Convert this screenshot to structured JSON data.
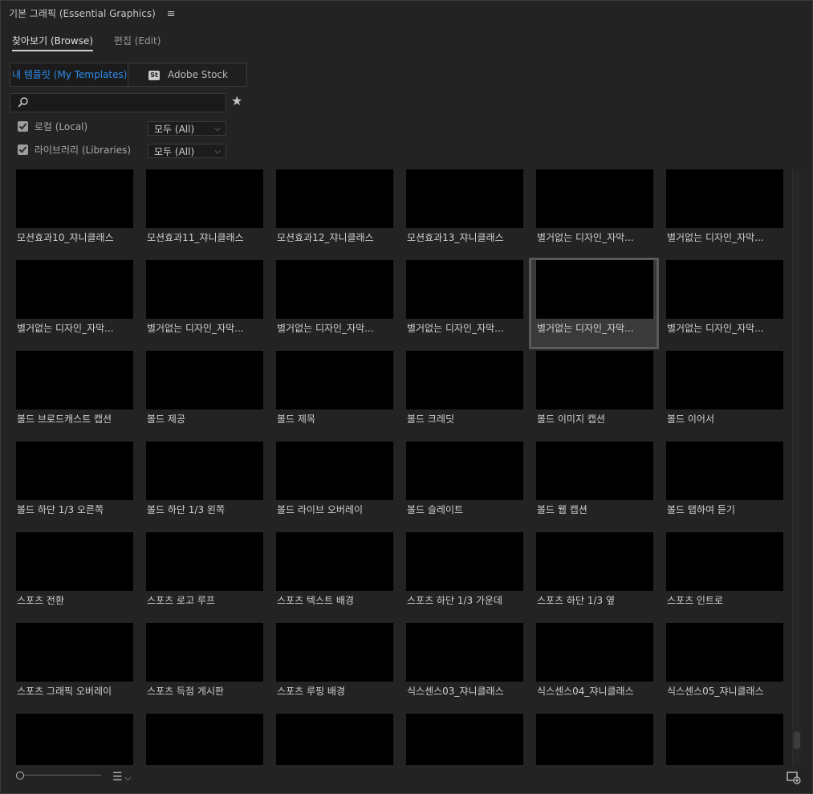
{
  "panel": {
    "title": "기본 그래픽 (Essential Graphics)",
    "menu_icon": "hamburger-icon"
  },
  "tabs": [
    {
      "label": "찾아보기 (Browse)",
      "active": true
    },
    {
      "label": "편집 (Edit)",
      "active": false
    }
  ],
  "source_toggle": {
    "my_templates": "내 템플릿 (My Templates)",
    "stock_badge": "St",
    "adobe_stock": "Adobe Stock"
  },
  "search": {
    "placeholder": "",
    "value": ""
  },
  "filters": [
    {
      "label": "로컬 (Local)",
      "checked": true,
      "dropdown": "모두 (All)"
    },
    {
      "label": "라이브러리 (Libraries)",
      "checked": true,
      "dropdown": "모두 (All)"
    }
  ],
  "templates": [
    [
      "모션효과10_쟈니클래스",
      "모션효과11_쟈니클래스",
      "모션효과12_쟈니클래스",
      "모션효과13_쟈니클래스",
      "별거없는 디자인_자막...",
      "별거없는 디자인_자막..."
    ],
    [
      "별거없는 디자인_자막...",
      "별거없는 디자인_자막...",
      "별거없는 디자인_자막...",
      "별거없는 디자인_자막...",
      "별거없는 디자인_자막...",
      "별거없는 디자인_자막..."
    ],
    [
      "볼드 브로드캐스트 캡션",
      "볼드 제공",
      "볼드 제목",
      "볼드 크레딧",
      "볼드 이미지 캡션",
      "볼드 이어서"
    ],
    [
      "볼드 하단 1/3 오른쪽",
      "볼드 하단 1/3 왼쪽",
      "볼드 라이브 오버레이",
      "볼드 슬레이트",
      "볼드 웹 캡션",
      "볼드 탭하여 듣기"
    ],
    [
      "스포츠 전환",
      "스포츠 로고 루프",
      "스포츠 텍스트 배경",
      "스포츠 하단 1/3 가운데",
      "스포츠 하단 1/3 옆",
      "스포츠 인트로"
    ],
    [
      "스포츠 그래픽 오버레이",
      "스포츠 득점 게시판",
      "스포츠 루핑 배경",
      "식스센스03_쟈니클래스",
      "식스센스04_쟈니클래스",
      "식스센스05_쟈니클래스"
    ],
    [
      "",
      "",
      "",
      "",
      "",
      ""
    ]
  ],
  "selected": {
    "row": 1,
    "col": 4
  },
  "colors": {
    "accent": "#2d8ceb",
    "panel_bg": "#232323",
    "thumb_bg": "#000000"
  }
}
